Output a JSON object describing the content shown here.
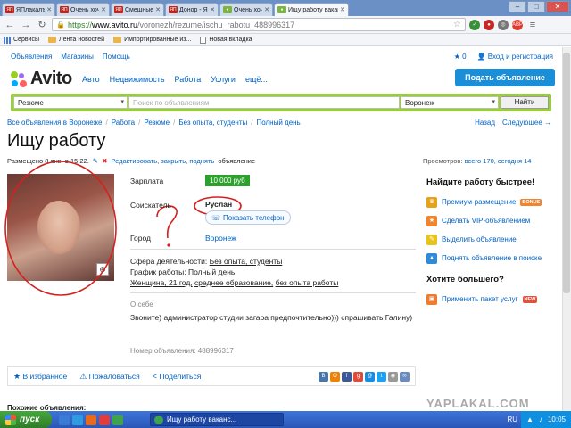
{
  "browser": {
    "tabs": [
      {
        "label": "ЯПлакалъ",
        "favicon": "yap"
      },
      {
        "label": "Очень хочу работ",
        "favicon": "yap"
      },
      {
        "label": "Смешные коммент",
        "favicon": "yap"
      },
      {
        "label": "Донор - ЯПлакалъ",
        "favicon": "yap"
      },
      {
        "label": "Очень хочу работ",
        "favicon": "green"
      },
      {
        "label": "Ищу работу вакан",
        "favicon": "green",
        "active": true
      }
    ],
    "url_proto": "https://",
    "url_host": "www.avito.ru",
    "url_path": "/voronezh/rezume/ischu_rabotu_488996317",
    "bookmarks": [
      "Сервисы",
      "Лента новостей",
      "Импортированные из...",
      "Новая вкладка"
    ]
  },
  "site": {
    "toplinks": [
      "Объявления",
      "Магазины",
      "Помощь"
    ],
    "favorites_count": "0",
    "login": "Вход и регистрация",
    "logo": "Avito",
    "nav": [
      "Авто",
      "Недвижимость",
      "Работа",
      "Услуги",
      "ещё..."
    ],
    "post_button": "Подать объявление",
    "search": {
      "category": "Резюме",
      "placeholder": "Поиск по объявлениям",
      "city": "Воронеж",
      "button": "Найти"
    }
  },
  "breadcrumbs": [
    "Все объявления в Воронеже",
    "Работа",
    "Резюме",
    "Без опыта, студенты",
    "Полный день"
  ],
  "pager": {
    "back": "Назад",
    "next": "Следующее →"
  },
  "ad": {
    "title": "Ищу работу",
    "posted": "Размещено 8 янв. в 15:22.",
    "edit": "Редактировать, закрыть, поднять",
    "edit_suffix": "объявление",
    "views_label": "Просмотров:",
    "views_value": "всего 170, сегодня 14",
    "salary_label": "Зарплата",
    "salary": "10 000 руб",
    "seeker_label": "Соискатель",
    "seeker": "Руслан",
    "phone_button": "Показать телефон",
    "city_label": "Город",
    "city": "Воронеж",
    "sphere_label": "Сфера деятельности:",
    "sphere": "Без опыта, студенты",
    "schedule_label": "График работы:",
    "schedule": "Полный день",
    "person": "Женщина, 21 год,",
    "education": "среднее образование,",
    "experience": "без опыта работы",
    "about_heading": "О себе",
    "about": "Звоните) администратор студии загара предпочтительно))) спрашивать Галину)",
    "ad_number": "Номер объявления: 488996317"
  },
  "actions": {
    "favorite": "В избранное",
    "complain": "Пожаловаться",
    "share": "Поделиться"
  },
  "similar_heading": "Похожие объявления:",
  "sidebar": {
    "heading1": "Найдите работу быстрее!",
    "items": [
      {
        "label": "Премиум-размещение",
        "badge": "BONUS",
        "color": "#e5a21a"
      },
      {
        "label": "Сделать VIP-объявлением",
        "color": "#f0842f"
      },
      {
        "label": "Выделить объявление",
        "color": "#e8c31a"
      },
      {
        "label": "Поднять объявление в поиске",
        "color": "#2e8bd8"
      }
    ],
    "heading2": "Хотите большего?",
    "package": {
      "label": "Применить пакет услуг",
      "badge": "NEW",
      "color": "#f07b2f"
    }
  },
  "watermark": "YAPLAKAL.COM",
  "taskbar": {
    "start": "пуск",
    "task": "Ищу работу ваканс...",
    "lang": "RU",
    "time": "10:05"
  }
}
